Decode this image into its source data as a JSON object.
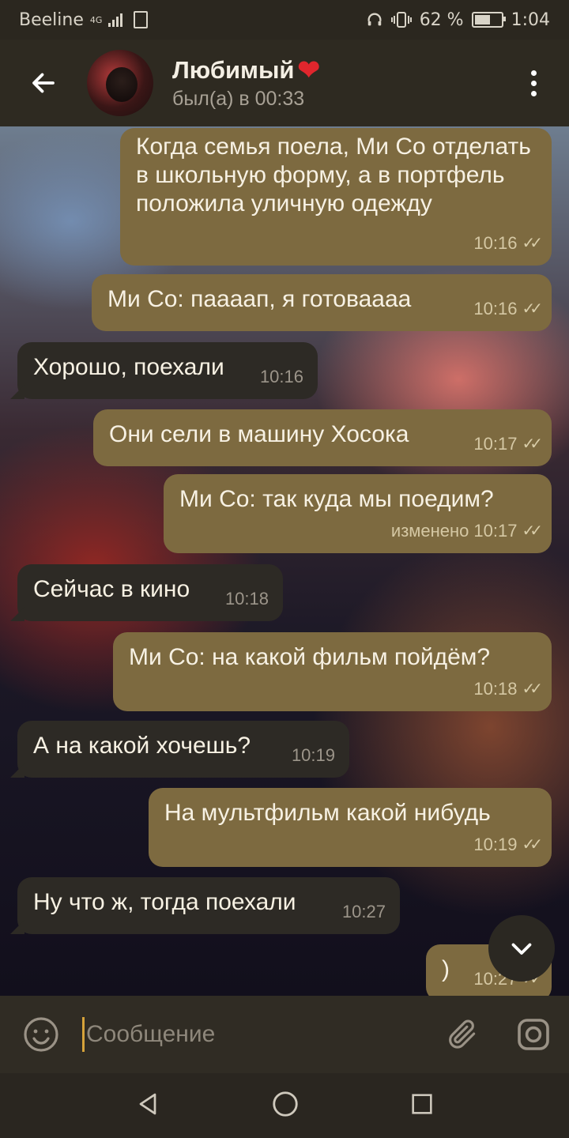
{
  "status_bar": {
    "carrier": "Beeline",
    "network": "4G",
    "battery_percent": "62 %",
    "battery_level": 0.62,
    "time": "1:04"
  },
  "header": {
    "contact_name": "Любимый",
    "heart_icon": "❤",
    "last_seen": "был(а) в 00:33"
  },
  "messages": [
    {
      "direction": "out",
      "text": "Когда семья поела, Ми Со отделать в школьную форму, а в портфель положила уличную одежду",
      "time": "10:16",
      "status": "read"
    },
    {
      "direction": "out",
      "text": "Ми Со: паааап, я готоваааа",
      "time": "10:16",
      "status": "read"
    },
    {
      "direction": "in",
      "text": "Хорошо, поехали",
      "time": "10:16"
    },
    {
      "direction": "out",
      "text": "Они сели в машину Хосока",
      "time": "10:17",
      "status": "read"
    },
    {
      "direction": "out",
      "text": "Ми Со: так куда мы поедим?",
      "edited": "изменено",
      "time": "10:17",
      "status": "read"
    },
    {
      "direction": "in",
      "text": "Сейчас в кино",
      "time": "10:18"
    },
    {
      "direction": "out",
      "text": "Ми Со: на какой фильм пойдём?",
      "time": "10:18",
      "status": "read"
    },
    {
      "direction": "in",
      "text": "А на какой хочешь?",
      "time": "10:19"
    },
    {
      "direction": "out",
      "text": "На мультфильм какой нибудь",
      "time": "10:19",
      "status": "read"
    },
    {
      "direction": "in",
      "text": "Ну что ж, тогда поехали",
      "time": "10:27"
    },
    {
      "direction": "out",
      "text": ")",
      "time": "10:27",
      "status": "read"
    }
  ],
  "input": {
    "placeholder": "Сообщение"
  },
  "colors": {
    "outgoing_bubble": "#7d6a40",
    "incoming_bubble": "#2d2a25",
    "header_bg": "#2e2a21"
  }
}
